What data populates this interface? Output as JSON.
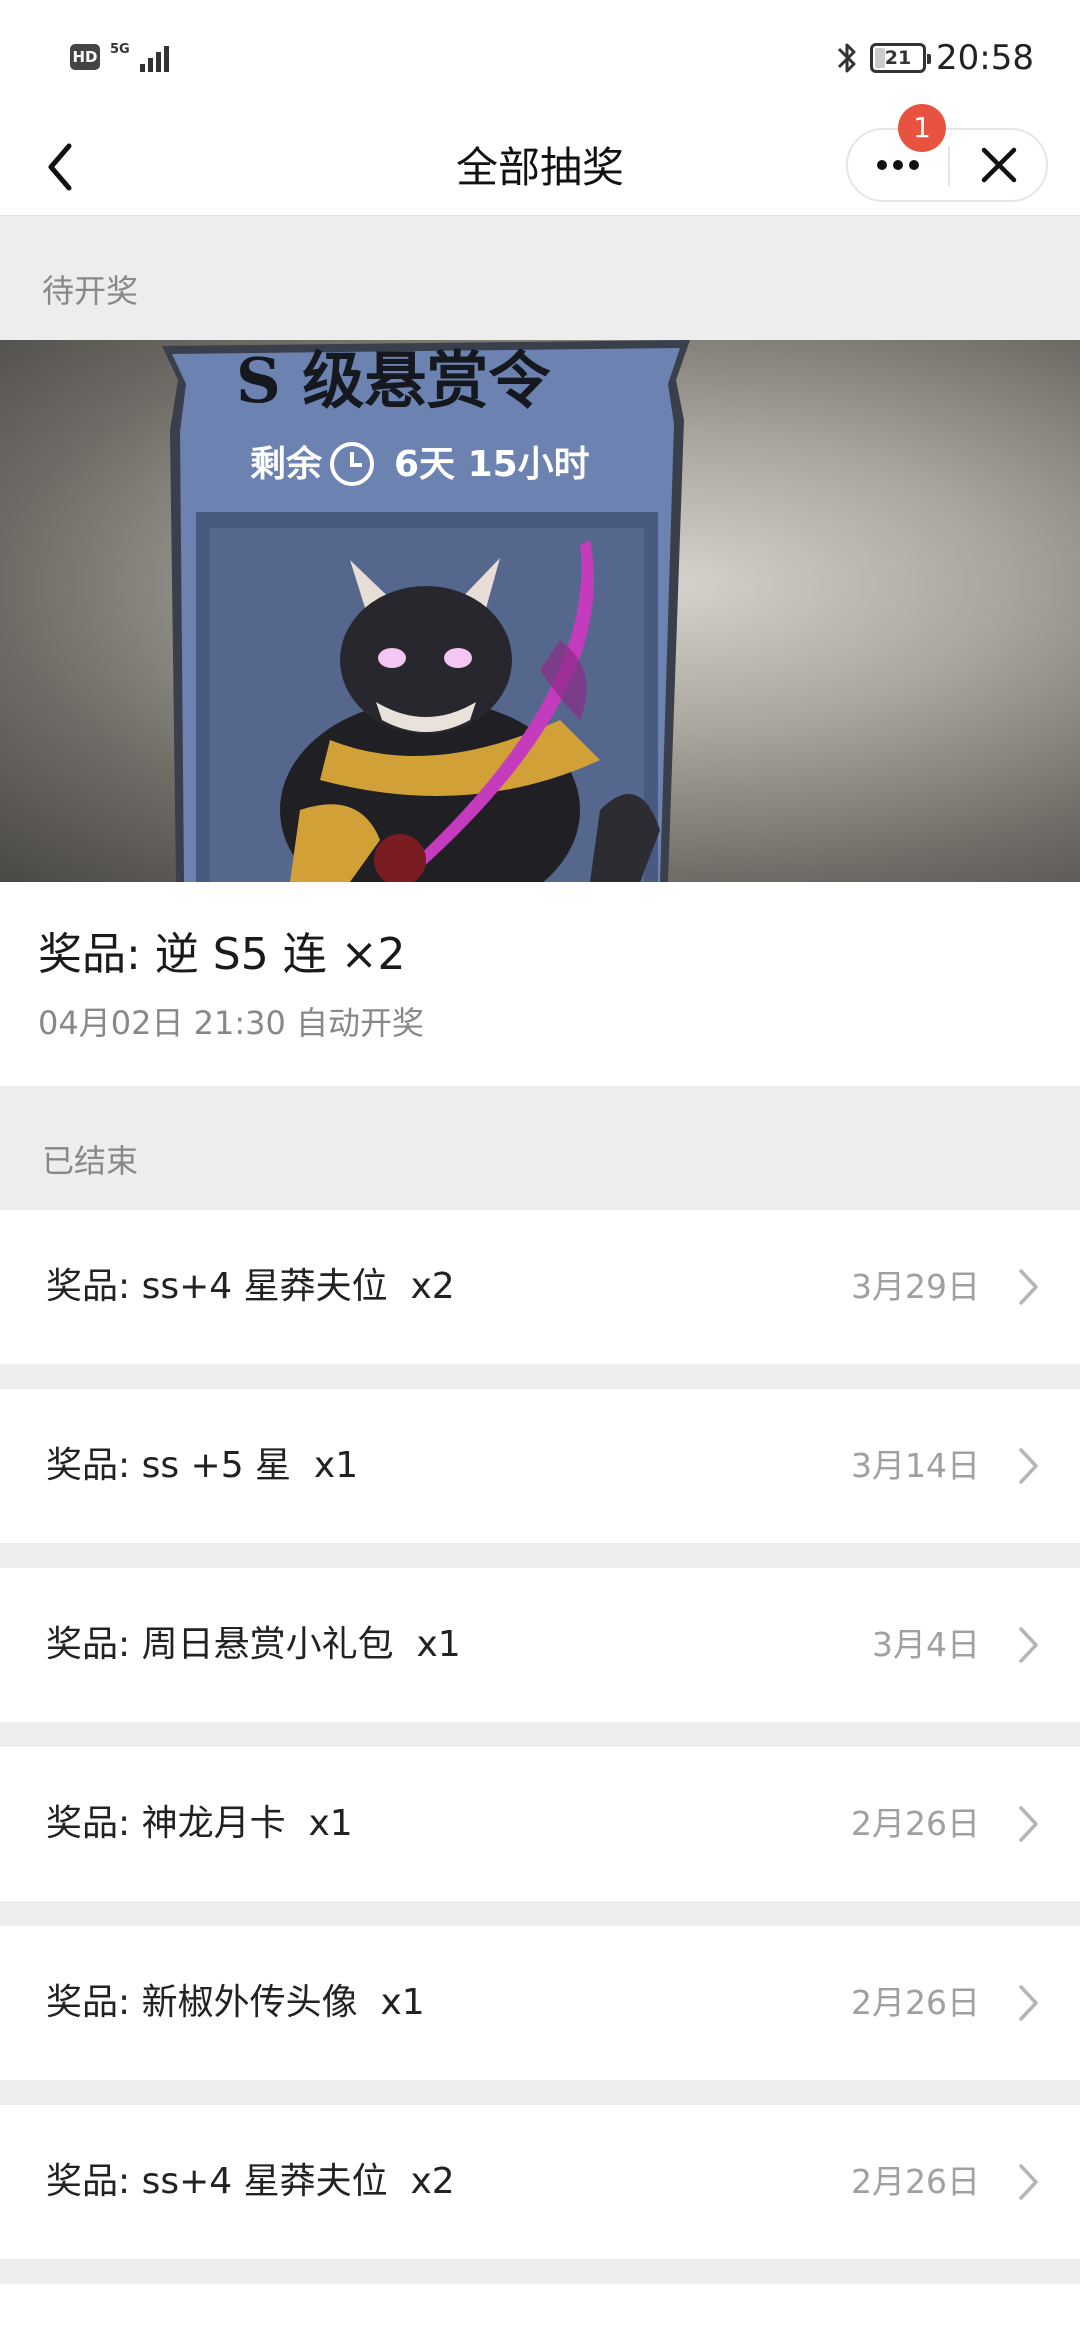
{
  "status_bar": {
    "hd_label": "HD",
    "network_label": "5G",
    "battery_level": "21",
    "time": "20:58"
  },
  "nav": {
    "title": "全部抽奖",
    "notification_count": "1"
  },
  "pending_section": {
    "header": "待开奖",
    "banner": {
      "poster_title": "S  级悬赏令",
      "poster_remaining_label": "剩余",
      "poster_remaining_time": "6天 15小时"
    },
    "prize_title": "奖品: 逆 S5 连 ×2",
    "draw_time": "04月02日 21:30 自动开奖"
  },
  "ended_section": {
    "header": "已结束",
    "items": [
      {
        "label": "奖品: ss+4 星莽夫位  x2",
        "date": "3月29日"
      },
      {
        "label": "奖品: ss +5 星  x1",
        "date": "3月14日"
      },
      {
        "label": "奖品: 周日悬赏小礼包  x1",
        "date": "3月4日"
      },
      {
        "label": "奖品: 神龙月卡  x1",
        "date": "2月26日"
      },
      {
        "label": "奖品: 新椒外传头像  x1",
        "date": "2月26日"
      },
      {
        "label": "奖品: ss+4 星莽夫位  x2",
        "date": "2月26日"
      }
    ]
  },
  "icons": {
    "back": "chevron-left-icon",
    "more": "more-dots-icon",
    "close": "close-icon",
    "row_arrow": "chevron-right-icon",
    "bluetooth": "bluetooth-icon",
    "clock": "clock-icon"
  },
  "colors": {
    "badge": "#e8533f",
    "background": "#ededed",
    "poster_blue": "#5a6f9a"
  }
}
